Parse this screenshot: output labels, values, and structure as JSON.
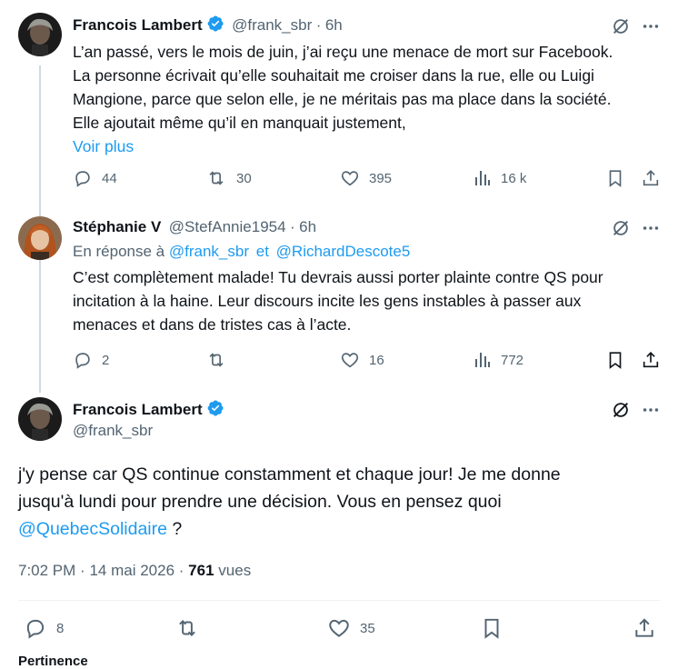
{
  "tweet1": {
    "name": "Francois Lambert",
    "handle": "@frank_sbr",
    "sep": "·",
    "time": "6h",
    "lines": [
      "L’an passé, vers le mois de juin, j’ai reçu une menace de mort sur Facebook.",
      "La personne écrivait qu’elle souhaitait me croiser dans la rue, elle ou Luigi",
      "Mangione, parce que selon elle, je ne méritais pas ma place dans la société.",
      "Elle ajoutait même qu’il en manquait justement,"
    ],
    "more": "Voir plus",
    "stats": {
      "replies": "44",
      "reposts": "30",
      "likes": "395",
      "views": "16 k"
    }
  },
  "tweet2": {
    "name": "Stéphanie V",
    "handle": "@StefAnnie1954",
    "sep": "·",
    "time": "6h",
    "reply_prefix": "En réponse à",
    "reply_to_1": "@frank_sbr",
    "reply_and": "et",
    "reply_to_2": "@RichardDescote5",
    "lines": [
      "C’est complètement malade! Tu devrais aussi porter plainte contre QS pour",
      "incitation à la haine. Leur discours incite les gens instables à passer aux",
      "menaces et dans de tristes cas à l’acte."
    ],
    "stats": {
      "replies": "2",
      "reposts": "",
      "likes": "16",
      "views": "772"
    }
  },
  "main": {
    "name": "Francois Lambert",
    "handle": "@frank_sbr",
    "line1": "j'y pense car QS continue constamment et chaque jour! Je me donne",
    "line2": "jusqu'à lundi pour prendre une décision. Vous en pensez quoi",
    "mention": "@QuebecSolidaire",
    "tail": " ?",
    "time": "7:02 PM",
    "sep": "·",
    "date": "14 mai 2026",
    "views_count": "761",
    "views_label": "vues",
    "stats": {
      "replies": "8",
      "likes": "35"
    }
  },
  "footer_partial": "Pertinence",
  "colors": {
    "accent": "#1d9bf0",
    "muted": "#536471",
    "text": "#0f1419",
    "line": "#cfd9de"
  },
  "icons": [
    "grok-icon",
    "more-icon",
    "reply-icon",
    "repost-icon",
    "like-icon",
    "views-icon",
    "bookmark-icon",
    "share-icon",
    "verified-badge-icon"
  ]
}
